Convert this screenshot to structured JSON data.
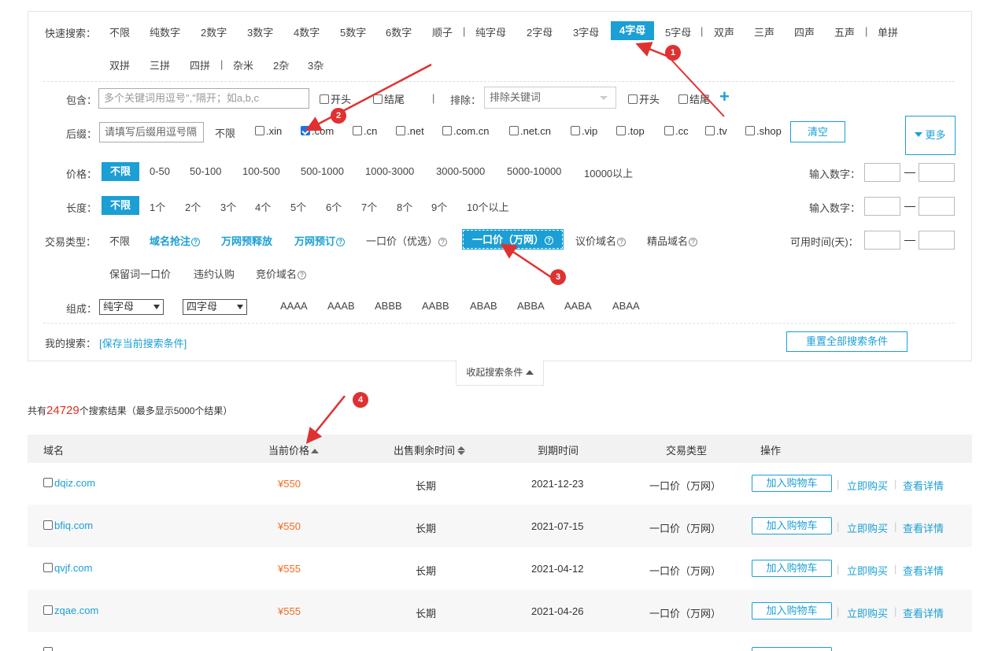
{
  "quick_search": {
    "label": "快速搜索：",
    "options": [
      "不限",
      "纯数字",
      "2数字",
      "3数字",
      "4数字",
      "5数字",
      "6数字",
      "顺子",
      "纯字母",
      "2字母",
      "3字母",
      "4字母",
      "5字母",
      "双声",
      "三声",
      "四声",
      "五声",
      "单拼",
      "双拼",
      "三拼",
      "四拼",
      "杂米",
      "2杂",
      "3杂"
    ],
    "selected": "4字母"
  },
  "include": {
    "label": "包含：",
    "placeholder": "多个关键词用逗号\",\"隔开；如a,b,c",
    "start_label": "开头",
    "end_label": "结尾",
    "exclude_label": "排除：",
    "exclude_placeholder": "排除关键词",
    "exclude_start_label": "开头",
    "exclude_end_label": "结尾",
    "add_symbol": "+"
  },
  "suffix": {
    "label": "后缀：",
    "placeholder": "请填写后缀用逗号隔",
    "unlimited": "不限",
    "options": [
      ".xin",
      ".com",
      ".cn",
      ".net",
      ".com.cn",
      ".net.cn",
      ".vip",
      ".top",
      ".cc",
      ".tv",
      ".shop"
    ],
    "checked": ".com",
    "clear_label": "清空",
    "more_label": "更多"
  },
  "price": {
    "label": "价格：",
    "options": [
      "不限",
      "0-50",
      "50-100",
      "100-500",
      "500-1000",
      "1000-3000",
      "3000-5000",
      "5000-10000",
      "10000以上"
    ],
    "selected": "不限",
    "input_label": "输入数字："
  },
  "length": {
    "label": "长度：",
    "options": [
      "不限",
      "1个",
      "2个",
      "3个",
      "4个",
      "5个",
      "6个",
      "7个",
      "8个",
      "9个",
      "10个以上"
    ],
    "selected": "不限",
    "input_label": "输入数字："
  },
  "trade_type": {
    "label": "交易类型：",
    "options": [
      "不限",
      "域名抢注",
      "万网预释放",
      "万网预订",
      "一口价（优选）",
      "一口价（万网）",
      "议价域名",
      "精品域名",
      "保留词一口价",
      "违约认购",
      "竞价域名"
    ],
    "selected": "一口价（万网）",
    "available_label": "可用时间(天)："
  },
  "compose": {
    "label": "组成：",
    "select1": "纯字母",
    "select2": "四字母",
    "patterns": [
      "AAAA",
      "AAAB",
      "ABBB",
      "AABB",
      "ABAB",
      "ABBA",
      "AABA",
      "ABAA"
    ]
  },
  "my_search": {
    "label": "我的搜索：",
    "save_link": "[保存当前搜索条件]",
    "reset_button": "重置全部搜索条件"
  },
  "collapse_label": "收起搜索条件",
  "results": {
    "prefix": "共有",
    "count": "24729",
    "suffix": "个搜索结果（最多显示5000个结果）"
  },
  "table": {
    "headers": [
      "域名",
      "当前价格",
      "出售剩余时间",
      "到期时间",
      "交易类型",
      "操作"
    ],
    "rows": [
      {
        "domain": "dqiz.com",
        "price": "¥550",
        "remaining": "长期",
        "expire": "2021-12-23",
        "type": "一口价（万网）"
      },
      {
        "domain": "bfiq.com",
        "price": "¥550",
        "remaining": "长期",
        "expire": "2021-07-15",
        "type": "一口价（万网）"
      },
      {
        "domain": "qvjf.com",
        "price": "¥555",
        "remaining": "长期",
        "expire": "2021-04-12",
        "type": "一口价（万网）"
      },
      {
        "domain": "zqae.com",
        "price": "¥555",
        "remaining": "长期",
        "expire": "2021-04-26",
        "type": "一口价（万网）"
      }
    ],
    "action_cart": "加入购物车",
    "action_buy": "立即购买",
    "action_detail": "查看详情"
  },
  "annotations": [
    "1",
    "2",
    "3",
    "4"
  ],
  "colors": {
    "accent": "#1b9fd4",
    "price": "#f36c21",
    "count": "#e0301e",
    "annotation": "#e03131"
  }
}
